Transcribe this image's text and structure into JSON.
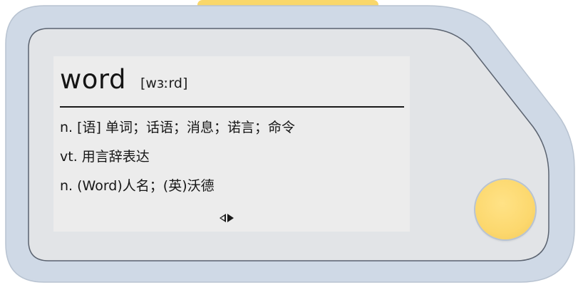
{
  "entry": {
    "headword": "word",
    "phonetic": "[wɜːrd]",
    "definitions": [
      "n. [语] 单词；话语；消息；诺言；命令",
      "vt. 用言辞表达",
      "n. (Word)人名；(英)沃德"
    ]
  },
  "icons": {
    "prev": "triangle-left-outline-icon",
    "next": "triangle-right-filled-icon"
  },
  "colors": {
    "body_outer": "#cfd9e6",
    "body_inner": "#e2e4e7",
    "screen_bg": "#ececec",
    "ink": "#141414",
    "button_yellow": "#fcd86e",
    "top_tab_yellow": "#f9d76a"
  }
}
